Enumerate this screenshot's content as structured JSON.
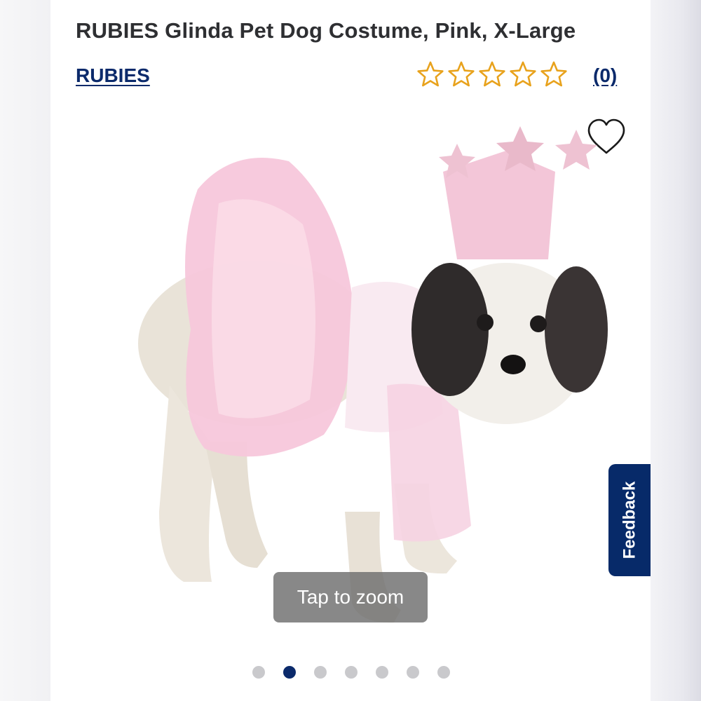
{
  "product": {
    "title": "RUBIES Glinda Pet Dog Costume, Pink, X-Large",
    "brand": "RUBIES",
    "rating": {
      "stars": 5,
      "filled": 0,
      "review_count": "(0)",
      "star_color": "#e8a21c"
    },
    "favorite_icon": "heart-outline-icon",
    "image": {
      "subject": "dog in pink Glinda costume with star crown"
    }
  },
  "gallery": {
    "zoom_label": "Tap to zoom",
    "dot_count": 7,
    "active_index": 1
  },
  "feedback": {
    "label": "Feedback",
    "color": "#072a69"
  },
  "colors": {
    "brand_link": "#0b2a6b",
    "title": "#2e2f32"
  }
}
